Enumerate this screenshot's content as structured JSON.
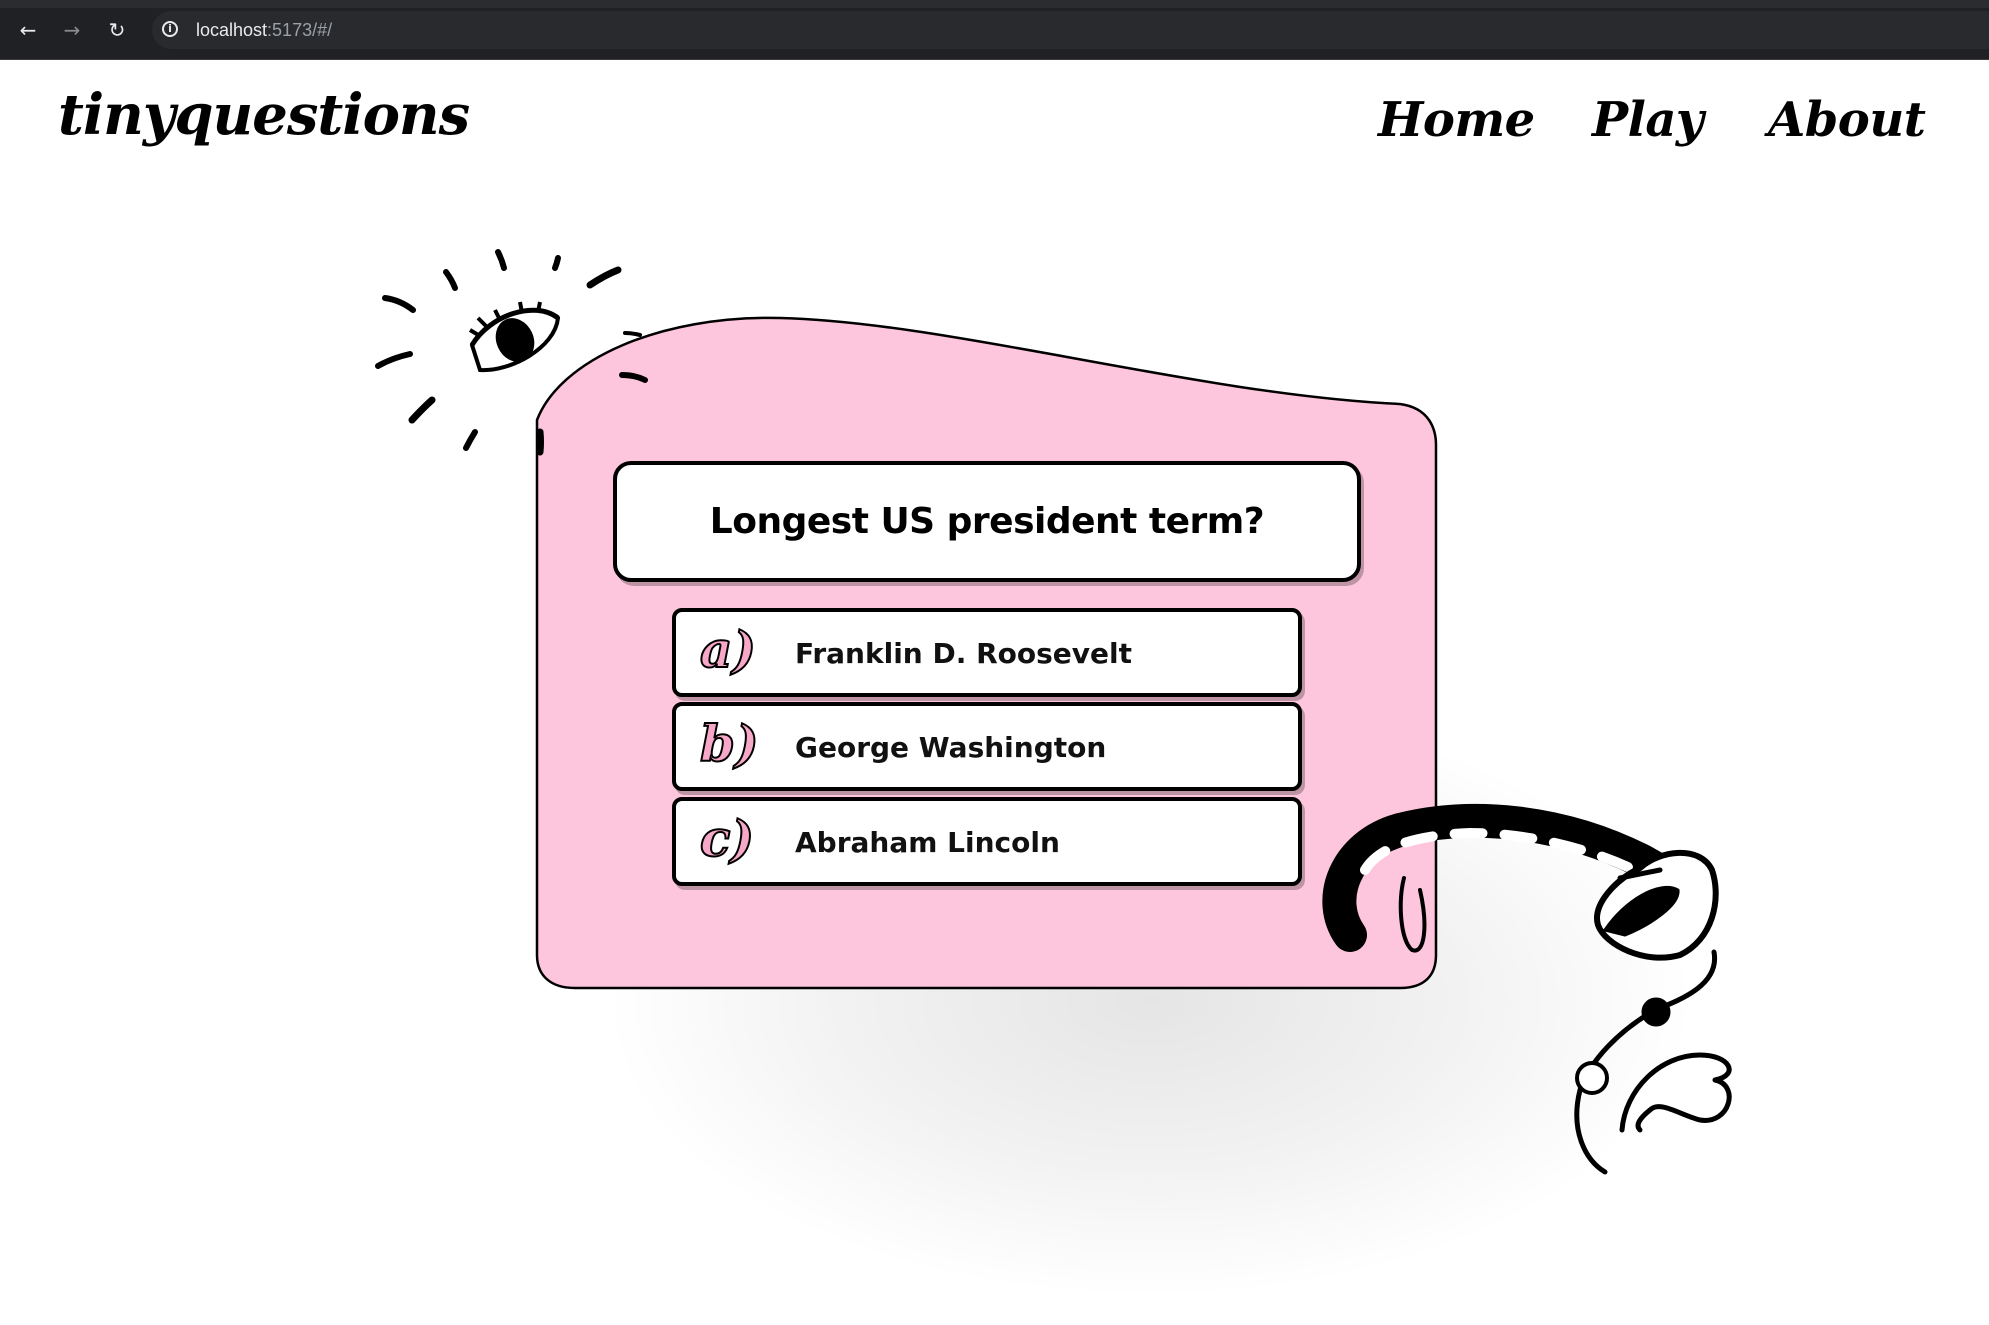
{
  "browser": {
    "url_host": "localhost",
    "url_rest": ":5173/#/"
  },
  "site": {
    "logo": "tinyquestions",
    "nav": {
      "home": "Home",
      "play": "Play",
      "about": "About"
    }
  },
  "quiz": {
    "question": "Longest US president term?",
    "answers": [
      {
        "letter": "a)",
        "label": "Franklin D. Roosevelt"
      },
      {
        "letter": "b)",
        "label": "George Washington"
      },
      {
        "letter": "c)",
        "label": "Abraham Lincoln"
      }
    ]
  },
  "colors": {
    "card": "#fec6dc",
    "letter_fill": "#f7a7c7",
    "browser_chrome": "#202124"
  }
}
